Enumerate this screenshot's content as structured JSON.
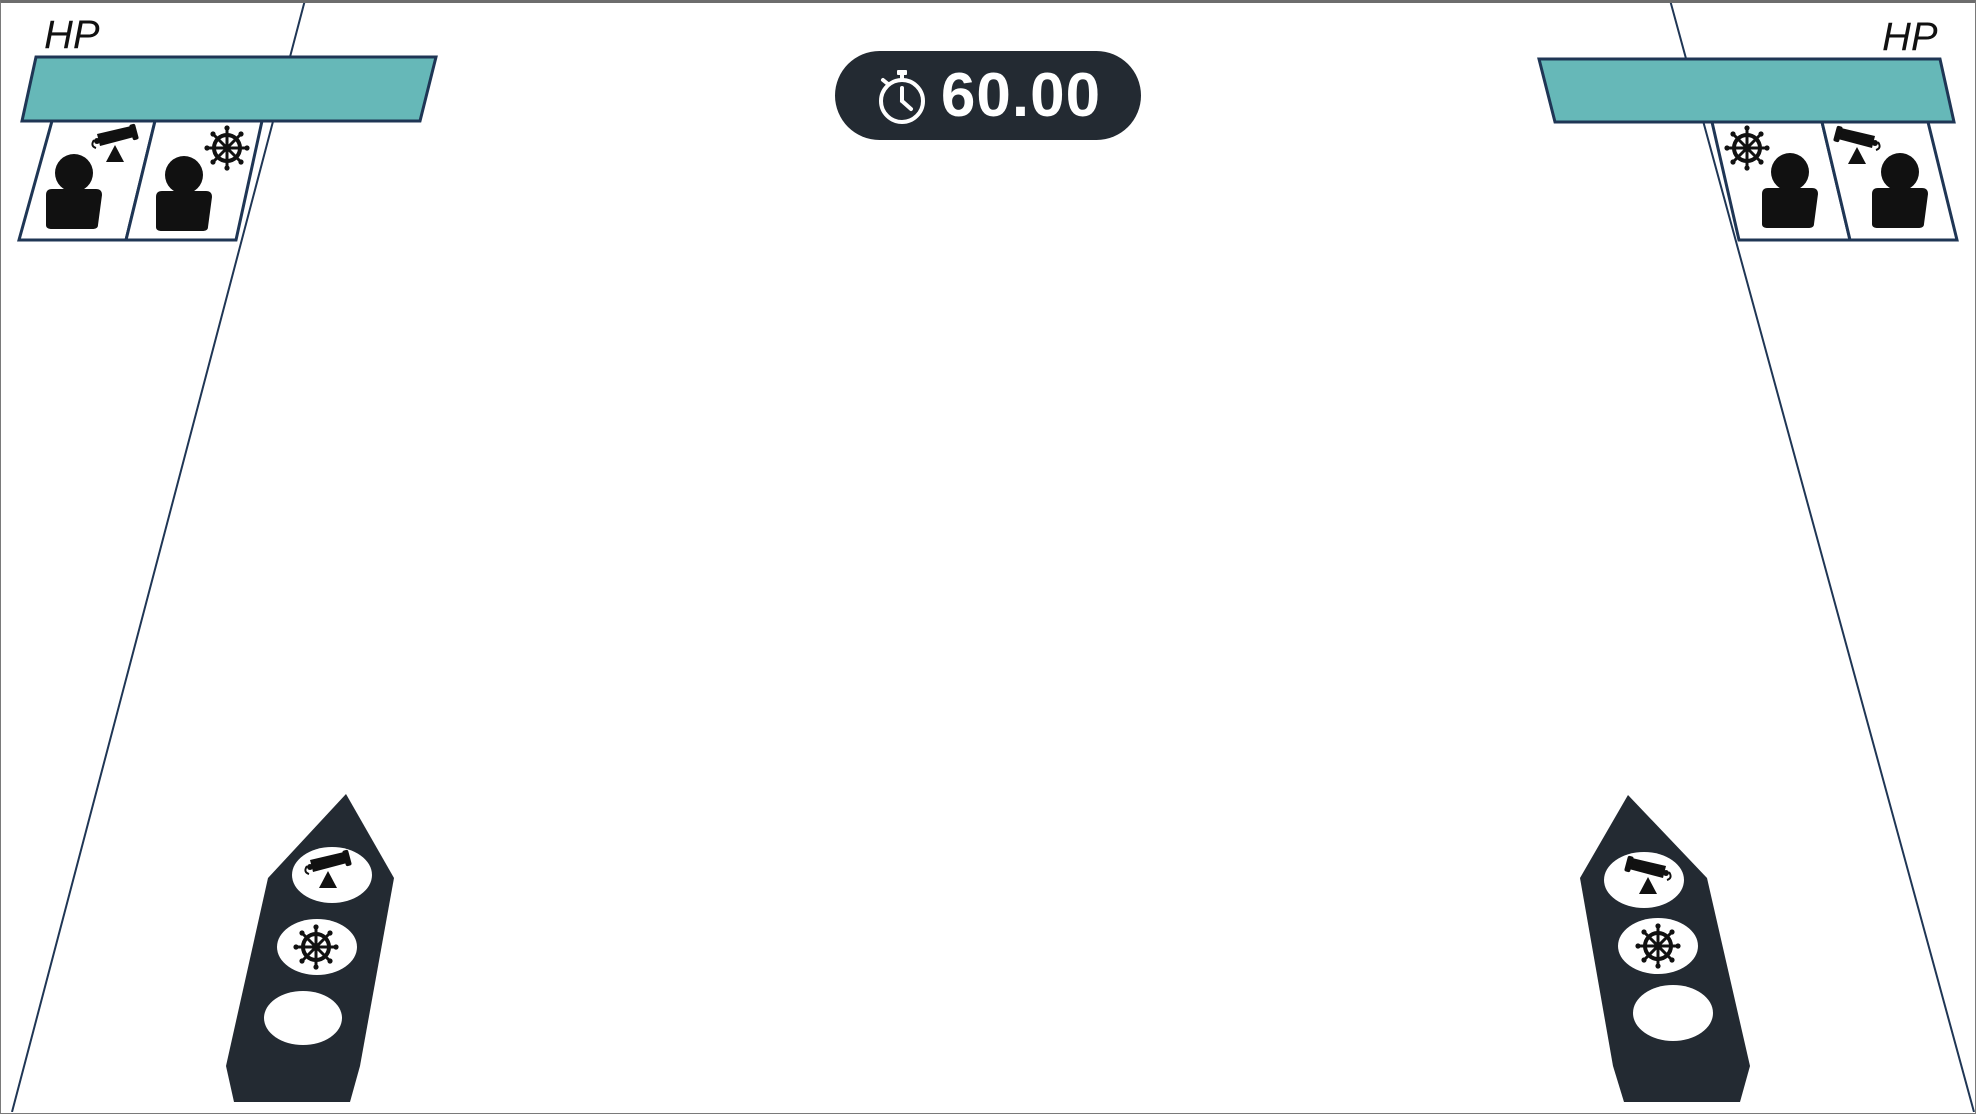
{
  "hud": {
    "timer": {
      "value": "60.00",
      "icon": "stopwatch-icon"
    },
    "left_team": {
      "hp_label": "HP",
      "hp_fraction": 1.0,
      "hp_color": "#66b8b8"
    },
    "right_team": {
      "hp_label": "HP",
      "hp_fraction": 1.0,
      "hp_color": "#66b8b8"
    }
  },
  "crew_slots": {
    "left": [
      {
        "role": "cannon-icon",
        "occupant": "player-icon"
      },
      {
        "role": "ship-wheel-icon",
        "occupant": "player-icon"
      }
    ],
    "right": [
      {
        "role": "ship-wheel-icon",
        "occupant": "player-icon"
      },
      {
        "role": "cannon-icon",
        "occupant": "player-icon"
      }
    ]
  },
  "ships": {
    "left": {
      "stations": [
        "cannon-icon",
        "ship-wheel-icon",
        "empty"
      ]
    },
    "right": {
      "stations": [
        "cannon-icon",
        "ship-wheel-icon",
        "empty"
      ]
    }
  },
  "colors": {
    "hp_bar": "#66b8b8",
    "outline": "#1f3655",
    "ship_hull": "#232a32",
    "timer_bg": "#232a32"
  }
}
